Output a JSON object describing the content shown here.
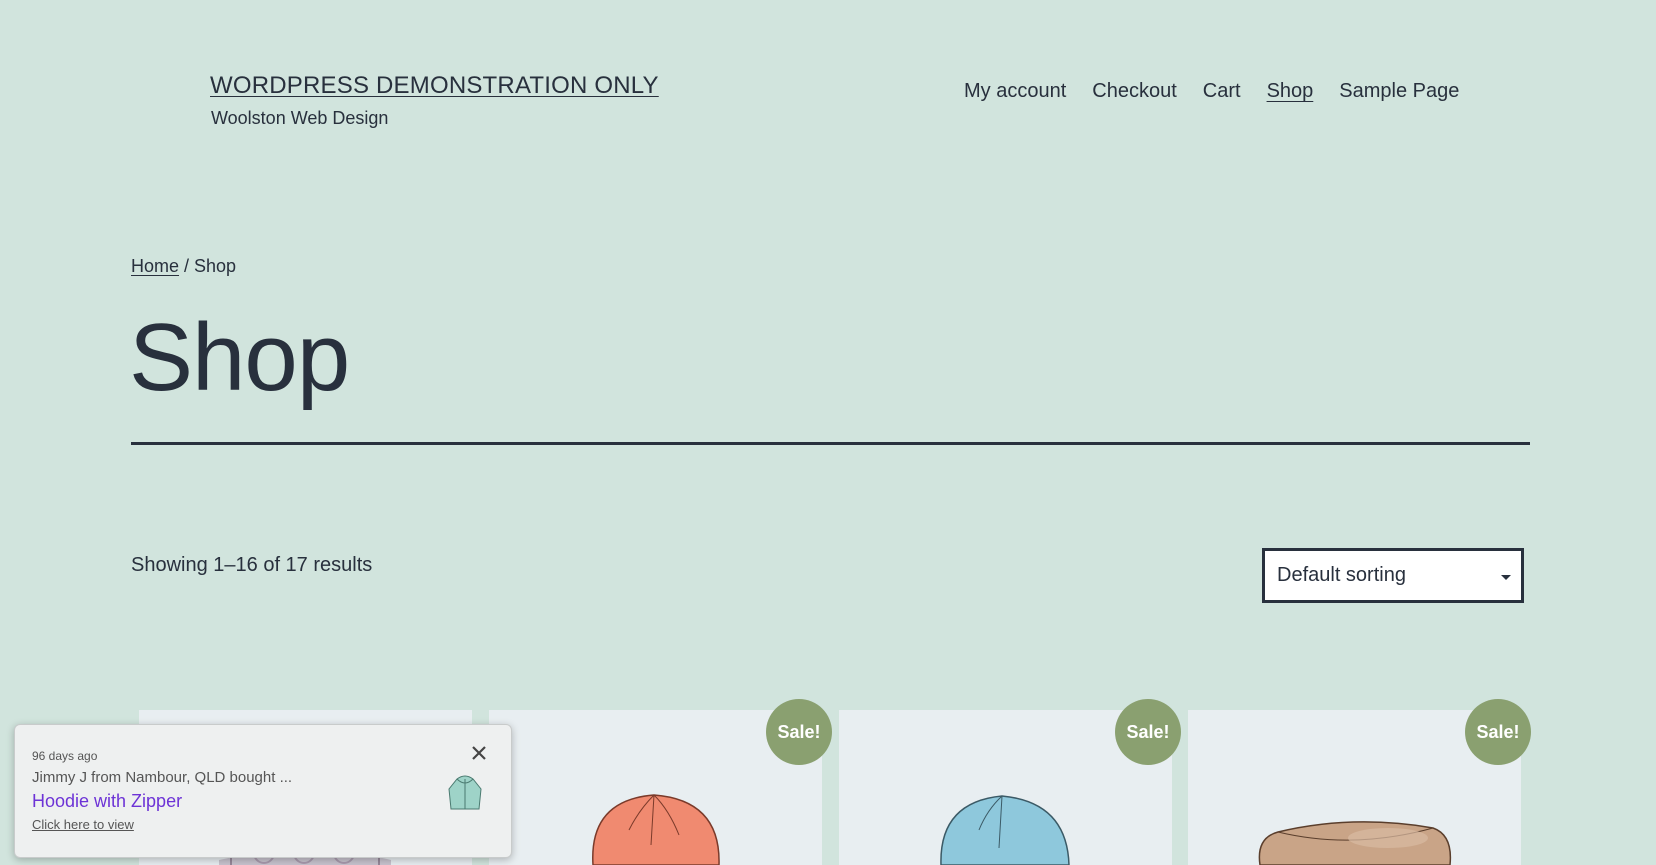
{
  "header": {
    "site_title": "WORDPRESS DEMONSTRATION ONLY",
    "tagline": "Woolston Web Design",
    "nav": [
      {
        "label": "My account",
        "current": false
      },
      {
        "label": "Checkout",
        "current": false
      },
      {
        "label": "Cart",
        "current": false
      },
      {
        "label": "Shop",
        "current": true
      },
      {
        "label": "Sample Page",
        "current": false
      }
    ]
  },
  "breadcrumb": {
    "home": "Home",
    "separator": " / ",
    "current": "Shop"
  },
  "page": {
    "title": "Shop"
  },
  "toolbar": {
    "result_count": "Showing 1–16 of 17 results",
    "sort_selected": "Default sorting"
  },
  "products": [
    {
      "sale_badge": ""
    },
    {
      "sale_badge": "Sale!"
    },
    {
      "sale_badge": "Sale!"
    },
    {
      "sale_badge": "Sale!"
    }
  ],
  "notification": {
    "time_ago": "96 days ago",
    "buyer": "Jimmy J from Nambour, QLD bought ...",
    "product": "Hoodie with Zipper",
    "cta": "Click here to view"
  },
  "colors": {
    "background": "#d1e4dd",
    "text": "#28303d",
    "sale_badge": "#8aa070",
    "link_purple": "#6d33d6"
  }
}
